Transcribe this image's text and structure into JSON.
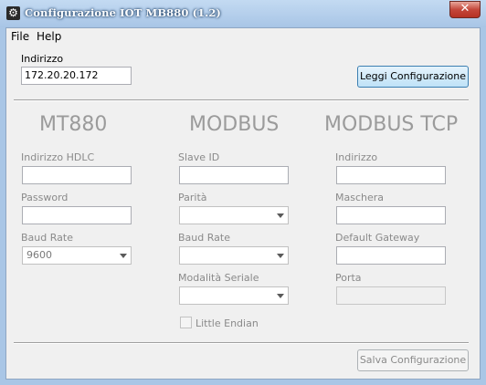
{
  "window": {
    "title": "Configurazione IOT MB880 (1.2)",
    "close_glyph": "✕",
    "app_icon_glyph": "⚙"
  },
  "menu": {
    "file": "File",
    "help": "Help"
  },
  "address": {
    "label": "Indirizzo",
    "value": "172.20.20.172"
  },
  "buttons": {
    "read": "Leggi Configurazione",
    "save": "Salva Configurazione"
  },
  "mt880": {
    "heading": "MT880",
    "hdlc_label": "Indirizzo HDLC",
    "hdlc_value": "",
    "password_label": "Password",
    "password_value": "",
    "baud_label": "Baud Rate",
    "baud_value": "9600"
  },
  "modbus": {
    "heading": "MODBUS",
    "slave_label": "Slave ID",
    "slave_value": "",
    "parity_label": "Parità",
    "parity_value": "",
    "baud_label": "Baud Rate",
    "baud_value": "",
    "serial_label": "Modalità Seriale",
    "serial_value": "",
    "endian_label": "Little Endian"
  },
  "modbus_tcp": {
    "heading": "MODBUS TCP",
    "address_label": "Indirizzo",
    "address_value": "",
    "mask_label": "Maschera",
    "mask_value": "",
    "gateway_label": "Default Gateway",
    "gateway_value": "",
    "port_label": "Porta",
    "port_value": ""
  }
}
